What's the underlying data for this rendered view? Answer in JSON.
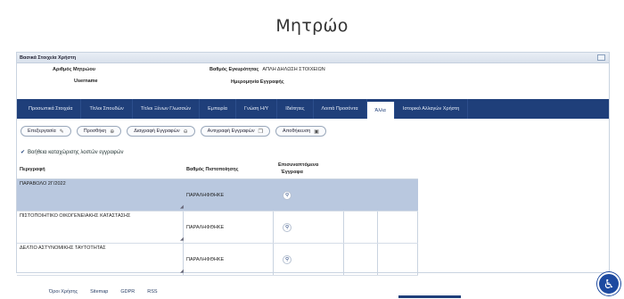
{
  "page": {
    "title": "Μητρώο"
  },
  "panel": {
    "header": "Βασικά Στοιχεία Χρήστη",
    "fields": [
      {
        "label": "Αριθμός Μητρώου",
        "value": ""
      },
      {
        "label": "Username",
        "value": ""
      },
      {
        "label": "Βαθμός Εγκυρότητας",
        "value": "ΑΠΛΗ ΔΗΛΩΣΗ ΣΤΟΙΧΕΙΩΝ"
      },
      {
        "label": "Ημερομηνία Εγγραφής",
        "value": ""
      }
    ]
  },
  "tabs": [
    {
      "label": "Προσωπικά Στοιχεία",
      "active": false
    },
    {
      "label": "Τίτλοι Σπουδών",
      "active": false
    },
    {
      "label": "Τίτλοι Ξένων Γλωσσών",
      "active": false
    },
    {
      "label": "Εμπειρία",
      "active": false
    },
    {
      "label": "Γνώση Η/Υ",
      "active": false
    },
    {
      "label": "Ιδιότητες",
      "active": false
    },
    {
      "label": "Λοιπά Προσόντα",
      "active": false
    },
    {
      "label": "Άλλα",
      "active": true
    },
    {
      "label": "Ιστορικό Αλλαγών Χρήστη",
      "active": false
    }
  ],
  "actions": {
    "edit": "Επεξεργασία",
    "add": "Προσθήκη",
    "delete": "Διαγραφή Εγγραφών",
    "copy": "Αντιγραφή Εγγραφών",
    "save": "Αποθήκευση"
  },
  "help": "Βοήθεια καταχώρισης λοιπών εγγραφών",
  "grid": {
    "columns": {
      "description": "Περιγραφή",
      "certification": "Βαθμός Πιστοποίησης",
      "attached_line1": "Επισυναπτόμενα",
      "attached_line2": "Έγγραφα"
    },
    "rows": [
      {
        "description": "ΠΑΡΑΒΟΛΟ 2Γ/2022",
        "status": "ΠΑΡΑΛΗΦΘΗΚΕ"
      },
      {
        "description": "ΠΙΣΤΟΠΟΙΗΤΙΚΟ ΟΙΚΟΓΕΝΕΙΑΚΗΣ ΚΑΤΑΣΤΑΣΗΣ",
        "status": "ΠΑΡΑΛΗΦΘΗΚΕ"
      },
      {
        "description": "ΔΕΛΤΙΟ ΑΣΤΥΝΟΜΙΚΗΣ ΤΑΥΤΟΤΗΤΑΣ",
        "status": "ΠΑΡΑΛΗΦΘΗΚΕ"
      }
    ]
  },
  "footer": {
    "terms": "Όροι Χρήσης",
    "sitemap": "Sitemap",
    "gdpr": "GDPR",
    "rss": "RSS"
  },
  "icons": {
    "edit": "pencil-icon",
    "add": "plus-circle-icon",
    "delete": "minus-circle-icon",
    "copy": "copy-icon",
    "save": "floppy-disk-icon",
    "view": "magnifier-icon",
    "accessibility": "accessibility-icon"
  },
  "colors": {
    "tabbar": "#1f3f7a",
    "selected_row": "#b9c8df",
    "accessibility": "#1d4aa0"
  }
}
